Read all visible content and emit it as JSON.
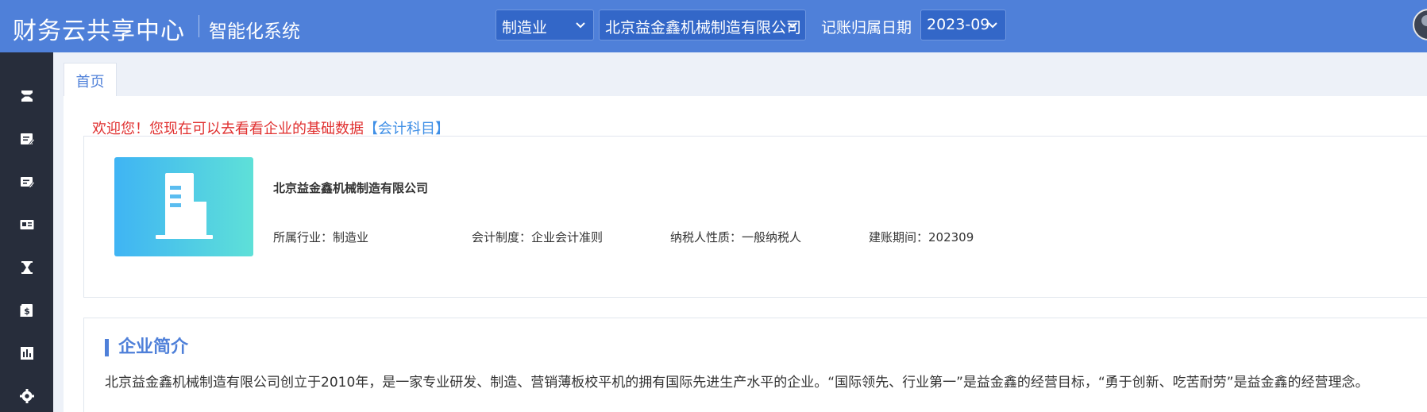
{
  "header": {
    "brand": "财务云共享中心",
    "subtitle": "智能化系统",
    "industry_select": "制造业",
    "company_select": "北京益金鑫机械制造有限公司",
    "period_label": "记账归属日期",
    "period_select": "2023-09"
  },
  "tabs": {
    "home": "首页"
  },
  "welcome": {
    "text": "欢迎您！您现在可以去看看企业的基础数据",
    "link": "【会计科目】"
  },
  "company": {
    "name": "北京益金鑫机械制造有限公司",
    "industry": "所属行业：制造业",
    "accounting_system": "会计制度：企业会计准则",
    "taxpayer_type": "纳税人性质：一般纳税人",
    "setup_period": "建账期间：202309"
  },
  "intro": {
    "title": "企业简介",
    "text": "北京益金鑫机械制造有限公司创立于2010年，是一家专业研发、制造、营销薄板校平机的拥有国际先进生产水平的企业。“国际领先、行业第一”是益金鑫的经营目标，“勇于创新、吃苦耐劳”是益金鑫的经营理念。"
  },
  "sidebar": {
    "icons": [
      "hourglass-list-icon",
      "edit-doc-icon",
      "edit-card-icon",
      "id-card-icon",
      "hourglass-icon",
      "money-book-icon",
      "bar-chart-icon",
      "gear-icon"
    ]
  },
  "colors": {
    "header": "#4f80d9",
    "sidebar": "#272d3b",
    "welcome": "#e03030",
    "link": "#3d8ee6"
  }
}
